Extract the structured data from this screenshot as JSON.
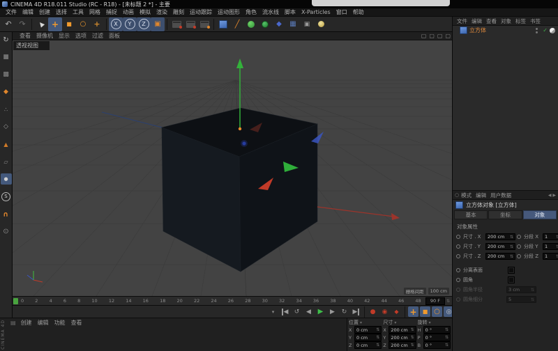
{
  "window": {
    "title": "CINEMA 4D R18.011 Studio (RC - R18) - [未标题 2 *] - 主要"
  },
  "menu_bar": {
    "items": [
      "文件",
      "编辑",
      "创建",
      "选择",
      "工具",
      "网格",
      "捕捉",
      "动画",
      "模拟",
      "渲染",
      "雕刻",
      "运动跟踪",
      "运动图形",
      "角色",
      "流水线",
      "脚本",
      "X-Particles",
      "窗口",
      "帮助"
    ]
  },
  "main_toolbar": {
    "icons": [
      "undo-icon",
      "redo-icon",
      "live-selection-icon",
      "move-tool-icon",
      "scale-tool-icon",
      "rotate-tool-icon",
      "last-used-tool-icon",
      "lock-x-axis-icon",
      "lock-y-axis-icon",
      "lock-z-axis-icon",
      "coordinate-system-icon",
      "render-view-icon",
      "render-to-picture-viewer-icon",
      "render-settings-icon",
      "cube-primitive-icon",
      "pen-spline-icon",
      "subdivision-surface-icon",
      "mograph-icon",
      "deformer-icon",
      "floor-icon",
      "camera-icon",
      "light-icon"
    ],
    "axis_locks": [
      "X",
      "Y",
      "Z"
    ]
  },
  "left_toolbar": {
    "icons": [
      "make-editable-icon",
      "model-mode-icon",
      "texture-mode-icon",
      "enable-axis-icon",
      "points-mode-icon",
      "edges-mode-icon",
      "polygons-mode-icon",
      "workplane-mode-icon",
      "viewport-solo-icon",
      "snap-settings-icon",
      "enable-snap-icon",
      "quantize-icon"
    ]
  },
  "viewport": {
    "menu": [
      "查看",
      "摄像机",
      "显示",
      "选项",
      "过滤",
      "面板"
    ],
    "label": "透视视图",
    "panel_icons": [
      "single-pane-icon",
      "two-pane-icon",
      "three-pane-icon",
      "four-pane-icon"
    ],
    "hud": {
      "label": "栅格间距",
      "value": "100 cm"
    },
    "scene_object": "立方体 (cube primitive, selected, axis gizmo visible)"
  },
  "timeline": {
    "ticks": [
      "0",
      "2",
      "4",
      "6",
      "8",
      "10",
      "12",
      "14",
      "16",
      "18",
      "20",
      "22",
      "24",
      "26",
      "28",
      "30",
      "32",
      "34",
      "36",
      "38",
      "40",
      "42",
      "44",
      "46",
      "48"
    ],
    "playhead_frame": "0",
    "end_frame": "90 F"
  },
  "animation_toolbar": {
    "icons": [
      "marker-icon",
      "goto-start-icon",
      "previous-key-icon",
      "previous-frame-icon",
      "play-icon",
      "next-frame-icon",
      "next-key-icon",
      "goto-end-icon",
      "record-active-objects-icon",
      "autokey-icon",
      "keyframe-selection-icon",
      "record-position-icon",
      "record-scale-icon",
      "record-rotation-icon",
      "record-parameter-icon",
      "record-pla-icon",
      "timeline-menu-icon"
    ]
  },
  "materials_panel": {
    "menu": [
      "创建",
      "编辑",
      "功能",
      "查看"
    ],
    "vertical_label": "CINEMA 4D"
  },
  "coordinates_manager": {
    "columns": [
      {
        "title": "位置",
        "rows": [
          {
            "axis": "X",
            "value": "0 cm"
          },
          {
            "axis": "Y",
            "value": "0 cm"
          },
          {
            "axis": "Z",
            "value": "0 cm"
          }
        ]
      },
      {
        "title": "尺寸",
        "rows": [
          {
            "axis": "X",
            "value": "200 cm"
          },
          {
            "axis": "Y",
            "value": "200 cm"
          },
          {
            "axis": "Z",
            "value": "200 cm"
          }
        ]
      },
      {
        "title": "旋转",
        "rows": [
          {
            "axis": "H",
            "value": "0 °"
          },
          {
            "axis": "P",
            "value": "0 °"
          },
          {
            "axis": "B",
            "value": "0 °"
          }
        ]
      }
    ]
  },
  "object_manager": {
    "menu": [
      "文件",
      "编辑",
      "查看",
      "对象",
      "标签",
      "书签"
    ],
    "objects": [
      {
        "name": "立方体",
        "enabled": true,
        "tags": [
          "phong-tag-icon"
        ]
      }
    ]
  },
  "attribute_manager": {
    "menu": [
      "模式",
      "编辑",
      "用户数据"
    ],
    "title": "立方体对象 [立方体]",
    "tabs": [
      {
        "label": "基本",
        "active": false
      },
      {
        "label": "坐标",
        "active": false
      },
      {
        "label": "对象",
        "active": true
      }
    ],
    "section": "对象属性",
    "dimension_rows": [
      {
        "dim_label": "尺寸 . X",
        "dim_value": "200 cm",
        "seg_label": "分段 X",
        "seg_value": "1"
      },
      {
        "dim_label": "尺寸 . Y",
        "dim_value": "200 cm",
        "seg_label": "分段 Y",
        "seg_value": "1"
      },
      {
        "dim_label": "尺寸 . Z",
        "dim_value": "200 cm",
        "seg_label": "分段 Z",
        "seg_value": "1"
      }
    ],
    "checkbox_rows": [
      {
        "label": "分离表面",
        "checked": false
      },
      {
        "label": "圆角",
        "checked": false
      }
    ],
    "disabled_rows": [
      {
        "label": "圆角半径",
        "value": "3 cm"
      },
      {
        "label": "圆角细分",
        "value": "5"
      }
    ]
  },
  "colors": {
    "accent_orange": "#e0862c",
    "active_blue": "#44597c",
    "axis_green": "#33b13a",
    "axis_red": "#9c342b",
    "axis_blue": "#2b4070",
    "viewport_bg": "#434343",
    "selected_object_text": "#e08a3c"
  }
}
